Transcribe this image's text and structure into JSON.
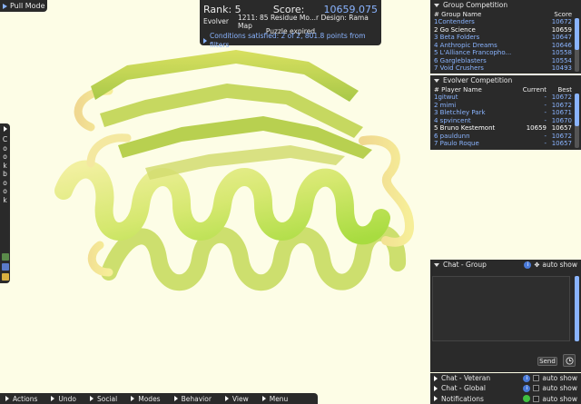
{
  "pull_mode": {
    "label": "Pull Mode"
  },
  "score_panel": {
    "rank_label": "Rank: 5",
    "score_label": "Score:",
    "score_value": "10659.075",
    "mode": "Evolver",
    "puzzle_title": "1211: 85 Residue Mo...r Design: Rama Map",
    "status": "Puzzle expired",
    "conditions": "Conditions satisfied: 2 of 2, 801.8 points from filters"
  },
  "cookbook": {
    "letters": [
      "C",
      "o",
      "o",
      "k",
      "b",
      "o",
      "o",
      "k"
    ]
  },
  "group_competition": {
    "title": "Group Competition",
    "headers": {
      "name": "# Group Name",
      "score": "Score"
    },
    "rows": [
      {
        "name": "1Contenders",
        "score": "10672",
        "me": false
      },
      {
        "name": "2 Go Science",
        "score": "10659",
        "me": true
      },
      {
        "name": "3 Beta Folders",
        "score": "10647",
        "me": false
      },
      {
        "name": "4 Anthropic Dreams",
        "score": "10646",
        "me": false
      },
      {
        "name": "5 L'Alliance Francopho...",
        "score": "10558",
        "me": false
      },
      {
        "name": "6 Gargleblasters",
        "score": "10554",
        "me": false
      },
      {
        "name": "7 Void Crushers",
        "score": "10493",
        "me": false
      }
    ]
  },
  "evolver_competition": {
    "title": "Evolver Competition",
    "headers": {
      "name": "# Player Name",
      "current": "Current",
      "best": "Best"
    },
    "rows": [
      {
        "name": "1gitwut",
        "current": "-",
        "best": "10672",
        "me": false
      },
      {
        "name": "2 mimi",
        "current": "-",
        "best": "10672",
        "me": false
      },
      {
        "name": "3 Bletchley Park",
        "current": "-",
        "best": "10671",
        "me": false
      },
      {
        "name": "4 spvincent",
        "current": "-",
        "best": "10670",
        "me": false
      },
      {
        "name": "5 Bruno Kestemont",
        "current": "10659",
        "best": "10657",
        "me": true
      },
      {
        "name": "6 pauldunn",
        "current": "-",
        "best": "10672",
        "me": false
      },
      {
        "name": "7 Paulo Roque",
        "current": "-",
        "best": "10657",
        "me": false
      }
    ]
  },
  "chat_group": {
    "title": "Chat - Group",
    "auto_show": "auto show",
    "send_label": "Send"
  },
  "chat_global": {
    "title": "Chat - Global",
    "auto_show": "auto show"
  },
  "chat_veteran": {
    "title": "Chat - Veteran",
    "auto_show": "auto show"
  },
  "notifications": {
    "title": "Notifications",
    "auto_show": "auto show"
  },
  "menu": [
    {
      "label": "Actions"
    },
    {
      "label": "Undo"
    },
    {
      "label": "Social"
    },
    {
      "label": "Modes"
    },
    {
      "label": "Behavior"
    },
    {
      "label": "View"
    },
    {
      "label": "Menu"
    }
  ],
  "colors": {
    "accent": "#8ab4ff",
    "panel": "#2a2a2a",
    "background": "#fdfde6"
  }
}
